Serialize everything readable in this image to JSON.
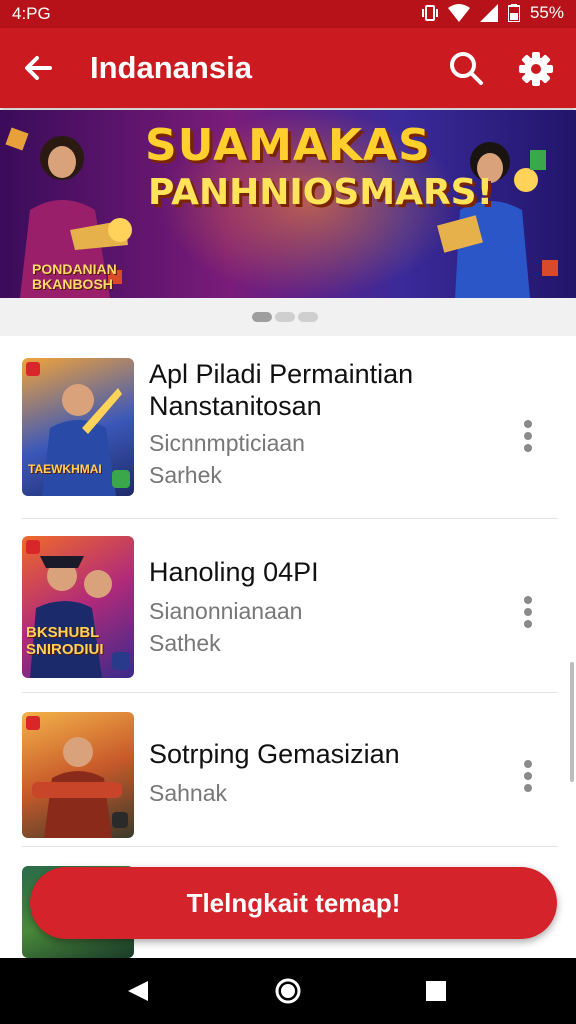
{
  "status_bar": {
    "time": "4:PG",
    "battery": "55%"
  },
  "app_bar": {
    "title": "Indanansia"
  },
  "banner": {
    "headline_1": "SUAMAKAS",
    "headline_2": "PANHNIOSMARS!",
    "subtitle_1": "PONDANIAN",
    "subtitle_2": "BKANBOSH"
  },
  "list": {
    "items": [
      {
        "title": "Apl Piladi Permaintian Nanstanitosan",
        "subtitle": "Sicnnmpticiaan",
        "meta": "Sarhek",
        "thumb_text": "TAEWKHMAI"
      },
      {
        "title": "Hanoling 04PI",
        "subtitle": "Sianonnianaan",
        "meta": "Sathek",
        "thumb_text": "BKSHUBL SNIRODIUI"
      },
      {
        "title": "Sotrping Gemasizian",
        "subtitle": "",
        "meta": "Sahnak",
        "thumb_text": ""
      }
    ]
  },
  "fab": {
    "label": "Tlelngkait temap!"
  },
  "colors": {
    "primary": "#cc1a21",
    "status_bar": "#b7121a",
    "accent": "#d4232a"
  }
}
